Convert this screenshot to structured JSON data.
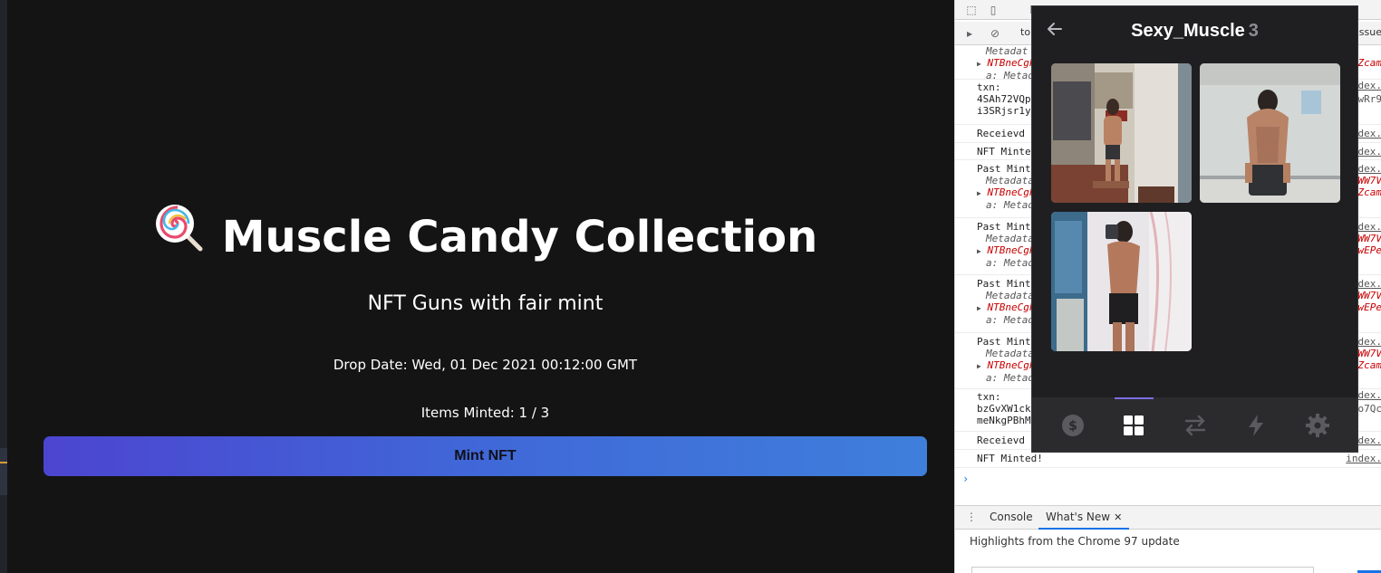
{
  "app": {
    "title": "Muscle Candy Collection",
    "subtitle": "NFT Guns with fair mint",
    "drop_date": "Drop Date: Wed, 01 Dec 2021 00:12:00 GMT",
    "items_minted": "Items Minted: 1 / 3",
    "mint_button": "Mint NFT",
    "icon": "lollipop-icon"
  },
  "devtools": {
    "context": "top",
    "issues": "Issue",
    "logs": [
      {
        "lines": [
          "Metadat"
        ],
        "red": "NTBneCgF",
        "red_right": "Zcam",
        "key": "a: Metad",
        "src": ""
      },
      {
        "txt": "txn:\n4SAh72VQp\ni3SRjsr1y",
        "src": "index.",
        "right": "wRr9"
      },
      {
        "txt": "Receievd",
        "src": "dex."
      },
      {
        "txt": "NFT Minte",
        "src": "dex."
      },
      {
        "txt": "Past Mint",
        "meta": "Metadata",
        "red": "NTBneCgF",
        "key": "a: Metad",
        "src": "dex.",
        "r1": "WW7V",
        "r2": "Zcam"
      },
      {
        "txt": "Past Mint",
        "meta": "Metadata",
        "red": "NTBneCgF",
        "key": "a: Metad",
        "src": "dex.",
        "r1": "WW7V",
        "r2": "wEPe"
      },
      {
        "txt": "Past Mint",
        "meta": "Metadata",
        "red": "NTBneCgF",
        "key": "a: Metad",
        "src": "dex.",
        "r1": "WW7V",
        "r2": "wEPe"
      },
      {
        "txt": "Past Mint",
        "meta": "Metadata",
        "red": "NTBneCgF",
        "key": "a: Metad",
        "src": "dex.",
        "r1": "WW7V",
        "r2": "Zcam"
      },
      {
        "txt": "txn:\nbzGvXW1ck\nmeNkgPBhM",
        "src": "index.",
        "right": "o7Qc"
      },
      {
        "txt": "Receievd",
        "src": "dex."
      },
      {
        "txt": "NFT Minted!",
        "src": "index."
      }
    ],
    "drawer_tabs": [
      "Console",
      "What's New"
    ],
    "highlights": "Highlights from the Chrome 97 update"
  },
  "wallet": {
    "title": "Sexy_Muscle",
    "count": "3",
    "back_icon": "arrow-left-icon",
    "nav": [
      "dollar-icon",
      "grid-icon",
      "swap-icon",
      "lightning-icon",
      "gear-icon"
    ],
    "active_nav": "grid-icon"
  },
  "colors": {
    "background": "#141414",
    "button_gradient_start": "#4c45d0",
    "button_gradient_end": "#3f7fdb",
    "wallet_bg": "#1f1f22",
    "accent": "#7b6ee0"
  }
}
